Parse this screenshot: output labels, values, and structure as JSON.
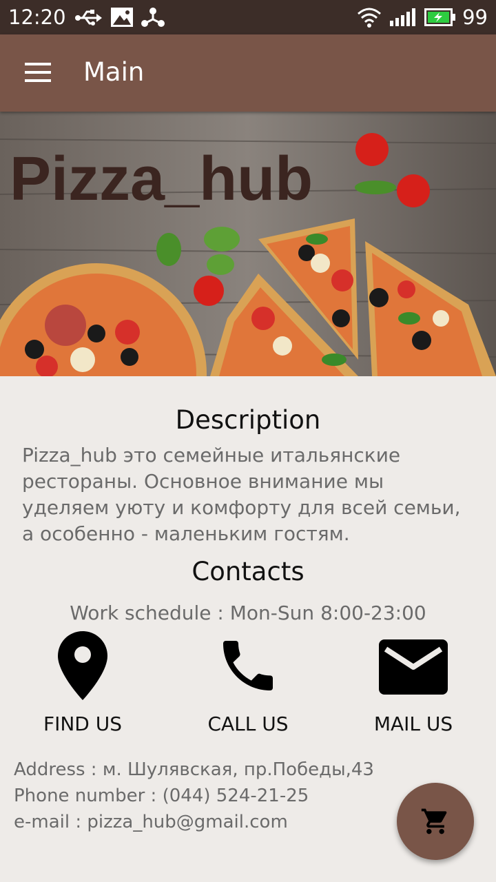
{
  "status_bar": {
    "time": "12:20",
    "battery": "99"
  },
  "app_bar": {
    "title": "Main"
  },
  "hero": {
    "brand": "Pizza_hub"
  },
  "description": {
    "heading": "Description",
    "text": "Pizza_hub это семейные итальянские рестораны. Основное внимание мы уделяем уюту и комфорту для всей семьи, а особенно - маленьким гостям."
  },
  "contacts": {
    "heading": "Contacts",
    "schedule": "Work schedule : Mon-Sun 8:00-23:00",
    "actions": [
      {
        "label": "FIND US",
        "icon": "map-pin-icon"
      },
      {
        "label": "CALL US",
        "icon": "phone-icon"
      },
      {
        "label": "MAIL US",
        "icon": "mail-icon"
      }
    ],
    "address": "Address : м. Шулявская, пр.Победы,43",
    "phone": "Phone number : (044) 524-21-25",
    "email": "e-mail : pizza_hub@gmail.com"
  },
  "fab": {
    "icon": "cart-icon"
  },
  "colors": {
    "status_bar": "#3c2d28",
    "app_bar": "#795548",
    "background": "#eeebe8",
    "accent": "#795548"
  }
}
